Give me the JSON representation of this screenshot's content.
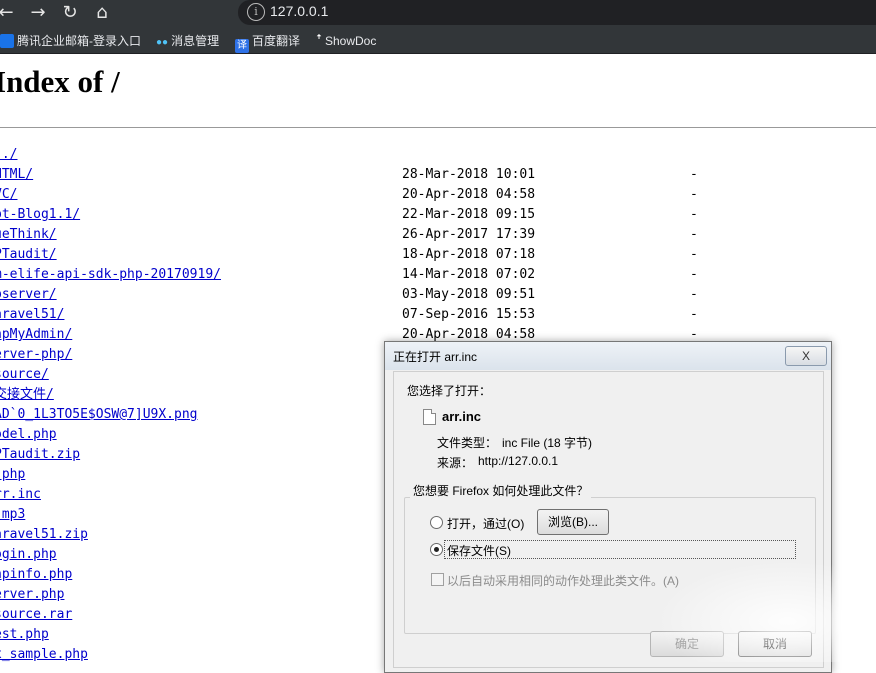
{
  "browser": {
    "url": "127.0.0.1",
    "bookmarks": [
      {
        "label": "腾讯企业邮箱-登录入口",
        "icon": "tencent-mail-icon",
        "color": "#1a73e8"
      },
      {
        "label": "消息管理",
        "icon": "dots-icon",
        "color": "#4fc3f7"
      },
      {
        "label": "百度翻译",
        "icon": "baidu-translate-icon",
        "color": "#2f72e8"
      },
      {
        "label": "ShowDoc",
        "icon": "showdoc-icon",
        "color": "#ffffff"
      }
    ]
  },
  "page": {
    "title": "Index of /",
    "entries": [
      {
        "name": "../",
        "date": "",
        "size": ""
      },
      {
        "name": "HTML/",
        "date": "28-Mar-2018 10:01",
        "size": "-"
      },
      {
        "name": "VC/",
        "date": "20-Apr-2018 04:58",
        "size": "-"
      },
      {
        "name": "pt-Blog1.1/",
        "date": "22-Mar-2018 09:15",
        "size": "-"
      },
      {
        "name": "ueThink/",
        "date": "26-Apr-2017 17:39",
        "size": "-"
      },
      {
        "name": "PTaudit/",
        "date": "18-Apr-2018 07:18",
        "size": "-"
      },
      {
        "name": "m-elife-api-sdk-php-20170919/",
        "date": "14-Mar-2018 07:02",
        "size": "-"
      },
      {
        "name": "pserver/",
        "date": "03-May-2018 09:51",
        "size": "-"
      },
      {
        "name": "aravel51/",
        "date": "07-Sep-2016 15:53",
        "size": "-"
      },
      {
        "name": "hpMyAdmin/",
        "date": "20-Apr-2018 04:58",
        "size": "-"
      },
      {
        "name": "erver-php/",
        "date": "",
        "size": ""
      },
      {
        "name": "source/",
        "date": "",
        "size": ""
      },
      {
        "name": "交接文件/",
        "date": "",
        "size": ""
      },
      {
        "name": "AD`0_1L3TO5E$OSW@7]U9X.png",
        "date": "",
        "size": ""
      },
      {
        "name": "odel.php",
        "date": "",
        "size": ""
      },
      {
        "name": "PTaudit.zip",
        "date": "",
        "size": ""
      },
      {
        "name": ".php",
        "date": "",
        "size": ""
      },
      {
        "name": "rr.inc",
        "date": "",
        "size": ""
      },
      {
        "name": ".mp3",
        "date": "",
        "size": ""
      },
      {
        "name": "aravel51.zip",
        "date": "",
        "size": ""
      },
      {
        "name": "ogin.php",
        "date": "",
        "size": ""
      },
      {
        "name": "hpinfo.php",
        "date": "",
        "size": ""
      },
      {
        "name": "erver.php",
        "date": "",
        "size": ""
      },
      {
        "name": "source.rar",
        "date": "",
        "size": ""
      },
      {
        "name": "est.php",
        "date": "",
        "size": ""
      },
      {
        "name": "x_sample.php",
        "date": "",
        "size": ""
      }
    ]
  },
  "dialog": {
    "title": "正在打开 arr.inc",
    "close": "X",
    "intro": "您选择了打开：",
    "filename": "arr.inc",
    "filetype_label": "文件类型：",
    "filetype_value": "inc File (18 字节)",
    "source_label": "来源：",
    "source_value": "http://127.0.0.1",
    "question": "您想要 Firefox 如何处理此文件？",
    "open_with": "打开，通过(O)",
    "browse": "浏览(B)...",
    "save_file": "保存文件(S)",
    "remember": "以后自动采用相同的动作处理此类文件。(A)",
    "ok": "确定",
    "cancel": "取消"
  }
}
